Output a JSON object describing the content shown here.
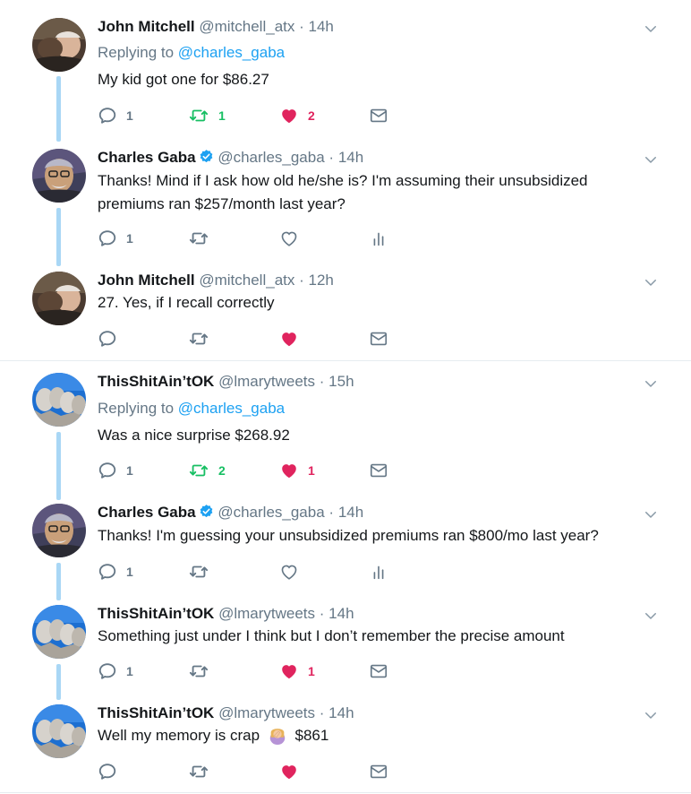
{
  "colors": {
    "accent": "#1da1f2",
    "retweet": "#17bf63",
    "like": "#e0245e",
    "muted": "#657786",
    "thread": "#a9d7f5"
  },
  "icons": [
    "reply-icon",
    "retweet-icon",
    "like-icon",
    "dm-icon",
    "analytics-icon",
    "verified-icon",
    "chevron-down-icon"
  ],
  "tweets": [
    {
      "name": "John Mitchell",
      "handle": "@mitchell_atx",
      "sep": "·",
      "time": "14h",
      "replying_prefix": "Replying to",
      "replying_to": "@charles_gaba",
      "text": "My kid got one for $86.27",
      "reply_count": "1",
      "retweet_count": "1",
      "like_count": "2",
      "liked": true,
      "retweeted": true
    },
    {
      "name": "Charles Gaba",
      "handle": "@charles_gaba",
      "sep": "·",
      "time": "14h",
      "verified": true,
      "text": "Thanks! Mind if I ask how old he/she is? I'm assuming their unsubsidized premiums ran $257/month last year?",
      "reply_count": "1"
    },
    {
      "name": "John Mitchell",
      "handle": "@mitchell_atx",
      "sep": "·",
      "time": "12h",
      "text": "27.  Yes, if I recall correctly",
      "liked": true
    },
    {
      "name": "ThisShitAin’tOK",
      "handle": "@lmarytweets",
      "sep": "·",
      "time": "15h",
      "replying_prefix": "Replying to",
      "replying_to": "@charles_gaba",
      "text": "Was a nice surprise $268.92",
      "reply_count": "1",
      "retweet_count": "2",
      "like_count": "1",
      "liked": true,
      "retweeted": true
    },
    {
      "name": "Charles Gaba",
      "handle": "@charles_gaba",
      "sep": "·",
      "time": "14h",
      "verified": true,
      "text": "Thanks! I'm guessing your unsubsidized premiums ran $800/mo last year?",
      "reply_count": "1"
    },
    {
      "name": "ThisShitAin’tOK",
      "handle": "@lmarytweets",
      "sep": "·",
      "time": "14h",
      "text": "Something just under I think but I don’t remember the precise amount",
      "reply_count": "1",
      "like_count": "1",
      "liked": true
    },
    {
      "name": "ThisShitAin’tOK",
      "handle": "@lmarytweets",
      "sep": "·",
      "time": "14h",
      "text_before": "Well my memory is crap",
      "text_after": "$861",
      "emoji_icon": "person-facepalming-icon",
      "liked": true
    }
  ]
}
